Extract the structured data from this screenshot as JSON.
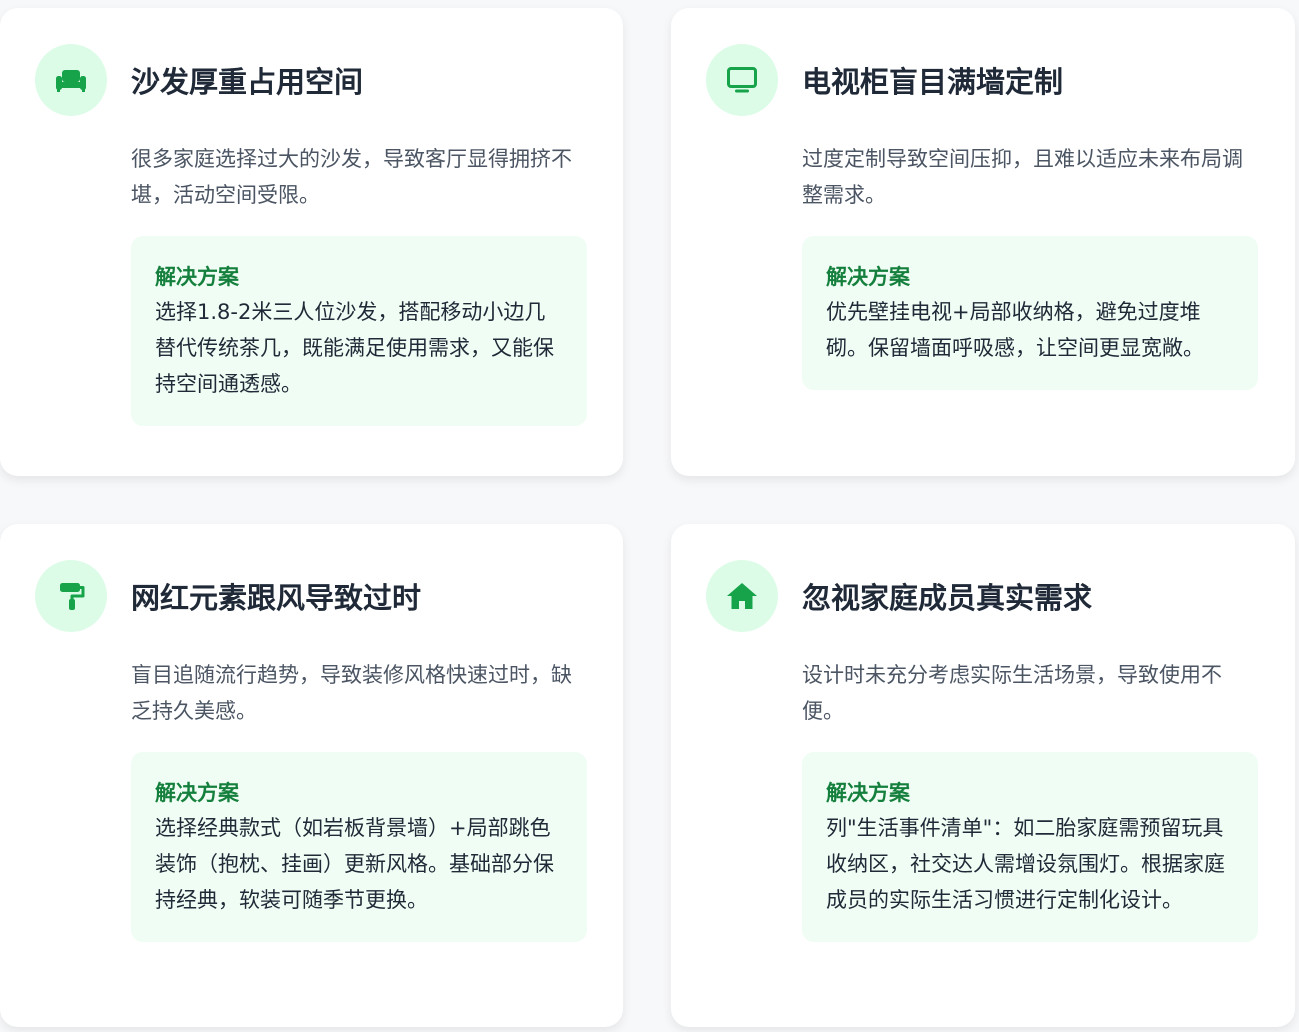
{
  "colors": {
    "accent": "#16a34a",
    "icon_bg": "#dcfce7",
    "solution_bg": "#f0fdf4",
    "solution_title": "#15803d"
  },
  "cards": [
    {
      "icon": "sofa-icon",
      "title": "沙发厚重占用空间",
      "description": "很多家庭选择过大的沙发，导致客厅显得拥挤不堪，活动空间受限。",
      "solution_title": "解决方案",
      "solution_text": "选择1.8-2米三人位沙发，搭配移动小边几替代传统茶几，既能满足使用需求，又能保持空间通透感。"
    },
    {
      "icon": "tv-icon",
      "title": "电视柜盲目满墙定制",
      "description": "过度定制导致空间压抑，且难以适应未来布局调整需求。",
      "solution_title": "解决方案",
      "solution_text": "优先壁挂电视+局部收纳格，避免过度堆砌。保留墙面呼吸感，让空间更显宽敞。"
    },
    {
      "icon": "paint-roller-icon",
      "title": "网红元素跟风导致过时",
      "description": "盲目追随流行趋势，导致装修风格快速过时，缺乏持久美感。",
      "solution_title": "解决方案",
      "solution_text": "选择经典款式（如岩板背景墙）+局部跳色装饰（抱枕、挂画）更新风格。基础部分保持经典，软装可随季节更换。"
    },
    {
      "icon": "home-icon",
      "title": "忽视家庭成员真实需求",
      "description": "设计时未充分考虑实际生活场景，导致使用不便。",
      "solution_title": "解决方案",
      "solution_text": "列\"生活事件清单\"：如二胎家庭需预留玩具收纳区，社交达人需增设氛围灯。根据家庭成员的实际生活习惯进行定制化设计。"
    }
  ]
}
